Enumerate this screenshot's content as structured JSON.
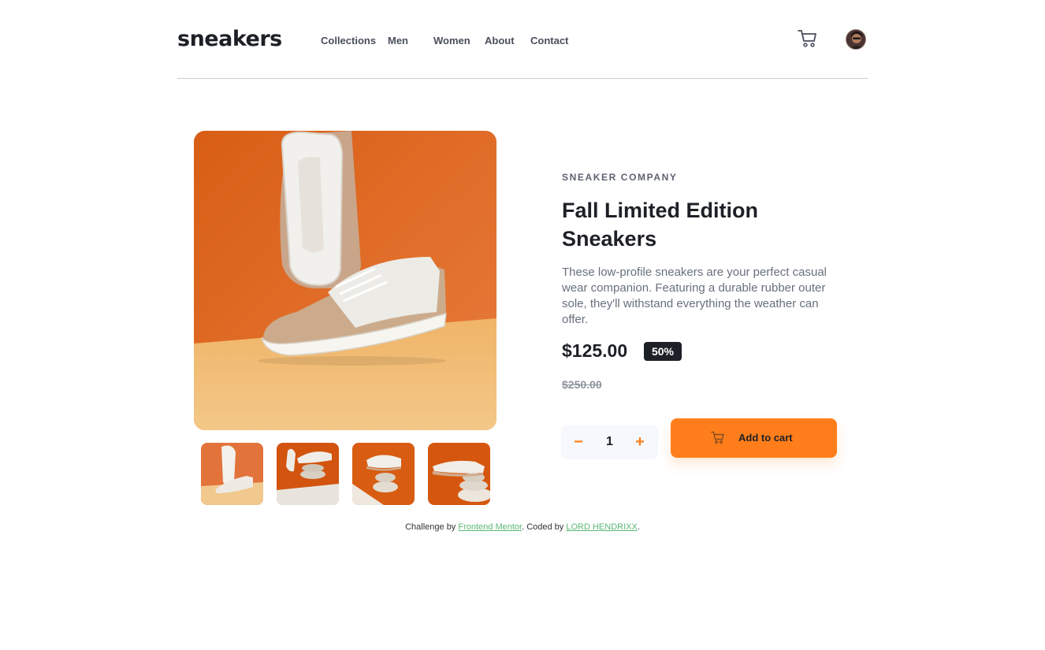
{
  "header": {
    "logo": "sneakers",
    "nav": [
      "Collections",
      "Men",
      "Women",
      "About",
      "Contact"
    ],
    "cart_icon": "cart-icon",
    "avatar": "user-avatar"
  },
  "gallery": {
    "hero_alt": "product-image-1",
    "thumbnails": [
      "thumbnail-1",
      "thumbnail-2",
      "thumbnail-3",
      "thumbnail-4"
    ]
  },
  "product": {
    "company": "SNEAKER COMPANY",
    "title": "Fall Limited Edition Sneakers",
    "description": "These low-profile sneakers are your perfect casual wear companion. Featuring a durable rubber outer sole, they'll withstand everything the weather can offer.",
    "price": "$125.00",
    "discount": "50%",
    "original_price": "$250.00"
  },
  "quantity": {
    "minus": "−",
    "value": "1",
    "plus": "+"
  },
  "add_to_cart": {
    "label": "Add to cart",
    "icon": "cart-icon"
  },
  "attribution": {
    "prefix": "Challenge by ",
    "link1": "Frontend Mentor",
    "middle": ". Coded by ",
    "link2": "LORD HENDRIXX",
    "suffix": "."
  },
  "colors": {
    "accent": "#ff7e1b",
    "dark": "#1d2026",
    "muted": "#68707d",
    "light_bg": "#f6f8fd"
  }
}
